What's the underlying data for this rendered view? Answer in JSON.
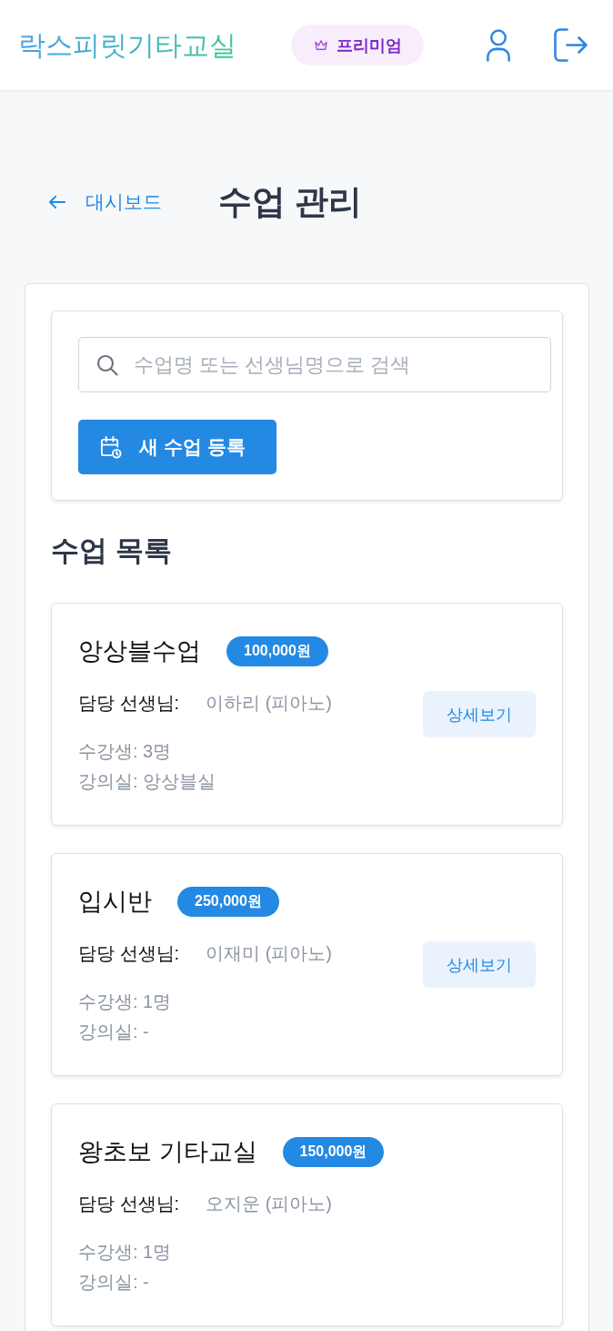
{
  "header": {
    "logo": "락스피릿기타교실",
    "premium_badge": "프리미엄"
  },
  "page": {
    "back_link": "대시보드",
    "title": "수업 관리"
  },
  "search": {
    "placeholder": "수업명 또는 선생님명으로 검색"
  },
  "new_button": "새 수업 등록",
  "list": {
    "title": "수업 목록",
    "items": [
      {
        "name": "앙상블수업",
        "price": "100,000원",
        "teacher_label": "담당 선생님:",
        "teacher": "이하리 (피아노)",
        "detail_button": "상세보기",
        "students": "수강생: 3명",
        "room": "강의실: 앙상블실"
      },
      {
        "name": "입시반",
        "price": "250,000원",
        "teacher_label": "담당 선생님:",
        "teacher": "이재미 (피아노)",
        "detail_button": "상세보기",
        "students": "수강생: 1명",
        "room": "강의실: -"
      },
      {
        "name": "왕초보 기타교실",
        "price": "150,000원",
        "teacher_label": "담당 선생님:",
        "teacher": "오지운 (피아노)",
        "students": "수강생: 1명",
        "room": "강의실: -"
      }
    ]
  }
}
